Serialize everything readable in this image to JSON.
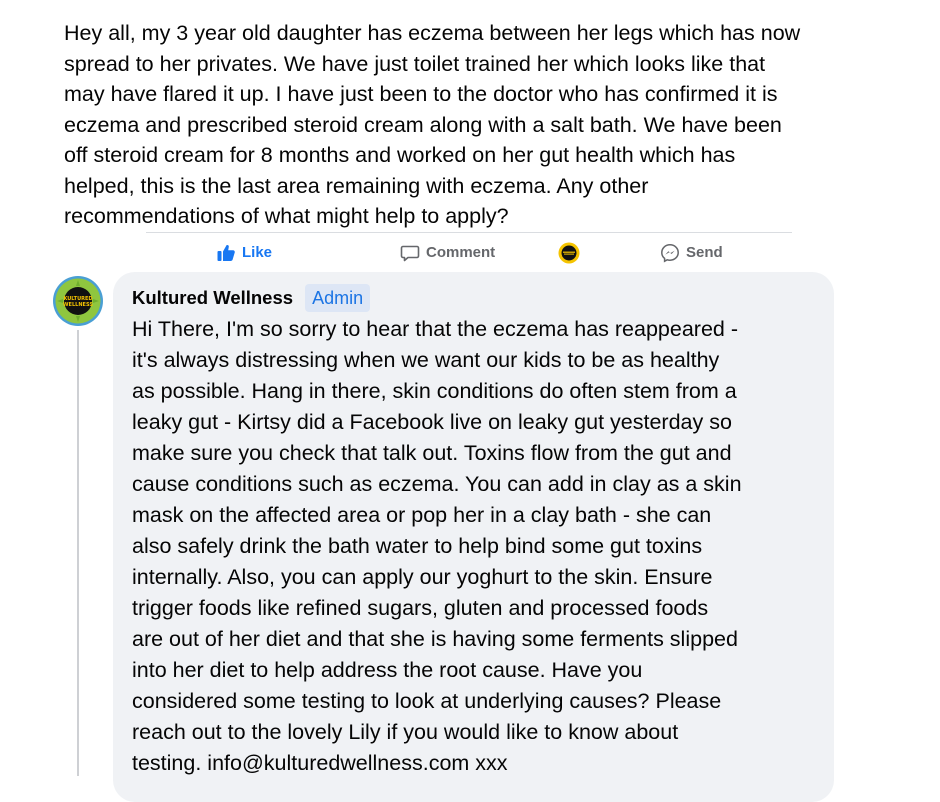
{
  "post": {
    "lines": [
      "Hey all, my 3 year old daughter has eczema between her legs which has now",
      "spread to her privates. We have just toilet trained her which looks like that",
      "may have flared it up. I have just been to the doctor who has confirmed it is",
      "eczema and prescribed steroid cream along with a salt bath. We have been",
      "off steroid cream for 8 months and worked on her gut health which has",
      "helped, this is the last area remaining with eczema. Any other",
      "recommendations of what might help to apply?"
    ]
  },
  "actions": {
    "like": "Like",
    "comment": "Comment",
    "send": "Send"
  },
  "icons": {
    "like": "thumbs-up-icon",
    "comment": "speech-bubble-icon",
    "react": "page-avatar-reaction-icon",
    "send": "messenger-icon"
  },
  "comment": {
    "author": "Kultured Wellness",
    "badge": "Admin",
    "avatar_text": [
      "KULTURED",
      "WELLNESS"
    ],
    "lines": [
      "Hi There, I'm so sorry to hear that the eczema has reappeared -",
      "it's always distressing when we want our kids to be as healthy",
      "as possible. Hang in there, skin conditions do often stem from a",
      "leaky gut - Kirtsy did a Facebook live on leaky gut yesterday so",
      "make sure you check that talk out. Toxins flow from the gut and",
      "cause conditions such as eczema. You can add in clay as a skin",
      "mask on the affected area or pop her in a clay bath - she can",
      "also safely drink the bath water to help bind some gut toxins",
      "internally. Also, you can apply our yoghurt to the skin. Ensure",
      "trigger foods like refined sugars, gluten and processed foods",
      "are out of her diet and that she is having some ferments slipped",
      "into her diet to help address the root cause. Have you",
      "considered some testing to look at underlying causes? Please",
      "reach out to the lovely Lily if you would like to know about",
      "testing. info@kulturedwellness.com xxx"
    ]
  },
  "colors": {
    "accent": "#1877f2",
    "admin_text": "#1b74e4",
    "bubble": "#f0f2f5",
    "avatar_green": "#8fc63f",
    "avatar_ring": "#4a9fd4"
  }
}
